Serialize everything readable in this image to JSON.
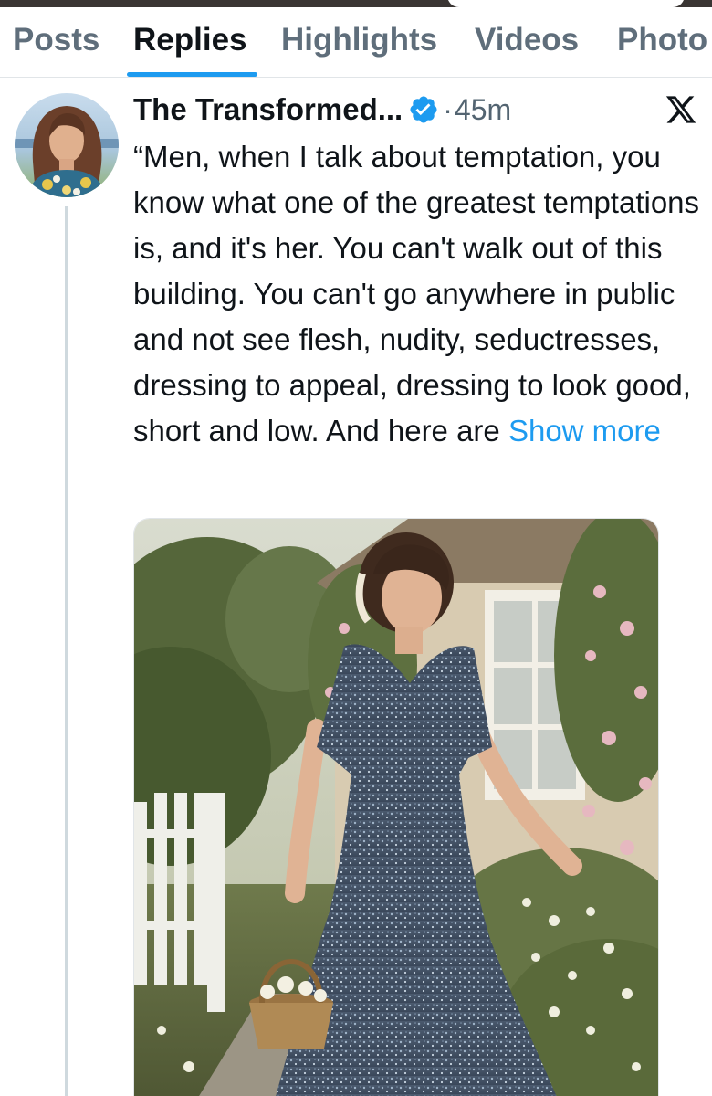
{
  "tabs": [
    {
      "label": "Posts"
    },
    {
      "label": "Replies"
    },
    {
      "label": "Highlights"
    },
    {
      "label": "Videos"
    },
    {
      "label": "Photo"
    }
  ],
  "active_tab": "Replies",
  "tweet": {
    "author_name": "The Transformed...",
    "separator": "·",
    "time": "45m",
    "text": "“Men, when I talk about temptation, you know what one of the greatest temptations is, and it's her. You can't walk out of this building. You can't go anywhere in public and not see flesh, nudity, seductresses, dressing to appeal, dressing to look good, short and low. And here are",
    "show_more_label": "Show more",
    "verified_icon": "verified-badge-icon",
    "platform_icon": "x-logo-icon"
  },
  "colors": {
    "accent": "#1d9bf0",
    "text_primary": "#0f1419",
    "text_secondary": "#536471",
    "tab_inactive": "#5f6e7b",
    "thread_line": "#cfd9de"
  }
}
